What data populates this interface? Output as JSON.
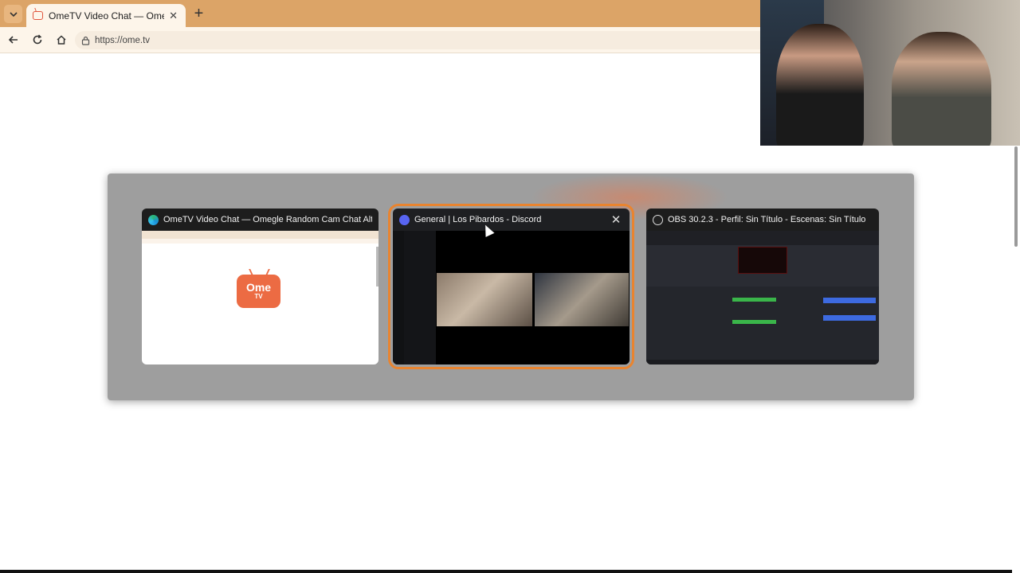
{
  "browser": {
    "tab_title": "OmeTV Video Chat — Omegle Random Cam Chat Alternative",
    "url": "https://ome.tv"
  },
  "switcher": {
    "windows": [
      {
        "title": "OmeTV Video Chat — Omegle Random Cam Chat Altern...",
        "app": "edge-icon",
        "selected": false
      },
      {
        "title": "General | Los Pibardos - Discord",
        "app": "discord-icon",
        "selected": true
      },
      {
        "title": "OBS 30.2.3 - Perfil: Sin Título - Escenas: Sin Título",
        "app": "obs-icon",
        "selected": false
      }
    ]
  },
  "ome_logo": {
    "ome": "Ome",
    "tv": "TV"
  },
  "colors": {
    "accent": "#e9842f",
    "tabbar": "#dca467",
    "ome_brand": "#ec6b43",
    "discord": "#5865f2"
  }
}
